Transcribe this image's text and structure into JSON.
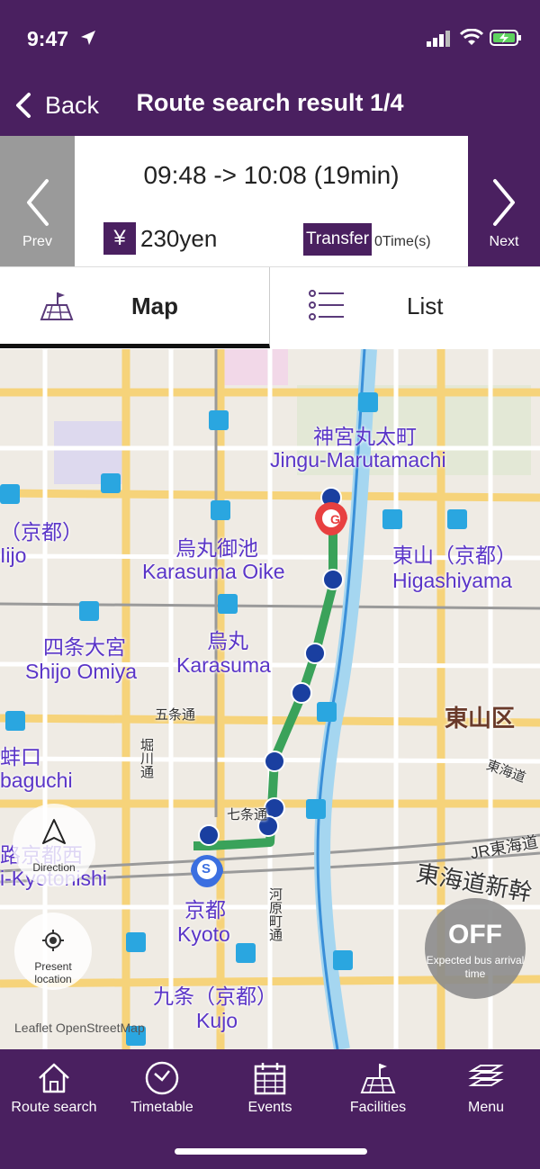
{
  "status_bar": {
    "time": "9:47"
  },
  "nav": {
    "back_label": "Back",
    "title": "Route search result 1/4"
  },
  "summary": {
    "prev_label": "Prev",
    "next_label": "Next",
    "time_range": "09:48 -> 10:08 (19min)",
    "yen_symbol": "¥",
    "fare": "230yen",
    "transfer_label": "Transfer",
    "transfer_count": "0Time(s)"
  },
  "tabs": {
    "map_label": "Map",
    "list_label": "List"
  },
  "map": {
    "labels": {
      "jingu_jp": "神宮丸太町",
      "jingu_en": "Jingu-Marutamachi",
      "karasuma_oike_jp": "烏丸御池",
      "karasuma_oike_en": "Karasuma Oike",
      "higashiyama_jp": "東山（京都）",
      "higashiyama_en": "Higashiyama",
      "karasuma_jp": "烏丸",
      "karasuma_en": "Karasuma",
      "shijo_omiya_jp": "四条大宮",
      "shijo_omiya_en": "Shijo Omiya",
      "higashiyama_ku": "東山区",
      "gojo_dori": "五条通",
      "kyoto_jp": "京都",
      "kyoto_en": "Kyoto",
      "kujo_jp": "九条（京都）",
      "kujo_en": "Kujo",
      "kyotonishi_jp": "路京都西",
      "kyotonishi_en": "i-Kyotonishi",
      "kyoto_left_jp": "（京都）",
      "ijo": "Iijo",
      "baguchi_jp": "蚌口",
      "baguchi_en": "baguchi",
      "jr_tokaido": "JR東海道",
      "tokaido_shinkansen": "東海道新幹",
      "tokaido_small": "東海道",
      "shichijo": "七条通",
      "kawaramachi": "河原町通",
      "horikawa": "堀川通",
      "start_marker": "S",
      "goal_marker": "G"
    },
    "direction_label": "Direction",
    "present_location_label": "Present location",
    "bus_toggle_state": "OFF",
    "bus_toggle_sub": "Expected bus arrival time",
    "attribution": "Leaflet OpenStreetMap",
    "route_color": "#3aa25a"
  },
  "tab_bar": {
    "items": [
      {
        "label": "Route search",
        "icon": "home-icon"
      },
      {
        "label": "Timetable",
        "icon": "clock-icon"
      },
      {
        "label": "Events",
        "icon": "calendar-icon"
      },
      {
        "label": "Facilities",
        "icon": "map-facilities-icon"
      },
      {
        "label": "Menu",
        "icon": "layers-icon"
      }
    ]
  },
  "colors": {
    "brand": "#4a2060",
    "prev_bg": "#9a9a9a",
    "route": "#3aa25a"
  }
}
